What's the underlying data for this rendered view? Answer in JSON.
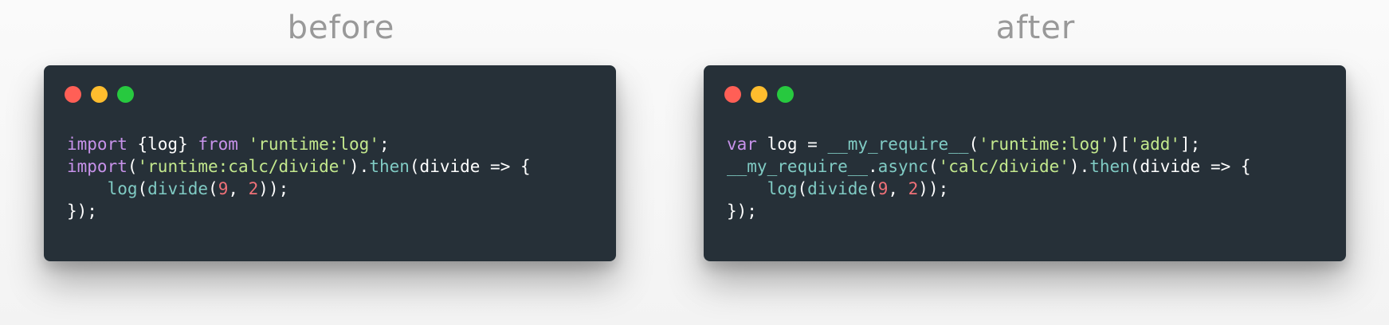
{
  "colors": {
    "background": "#f7f7f7",
    "window": "#263038",
    "label": "#999999",
    "traffic_red": "#ff5f56",
    "traffic_yellow": "#ffbd2e",
    "traffic_green": "#27c93f",
    "keyword": "#c792ea",
    "function": "#80cbc4",
    "string": "#c3e88d",
    "number": "#f07178",
    "text": "#ffffff"
  },
  "panels": [
    {
      "label": "before",
      "lines": [
        [
          {
            "t": "import",
            "c": "kw"
          },
          {
            "t": " {log} ",
            "c": "plain"
          },
          {
            "t": "from",
            "c": "kw"
          },
          {
            "t": " ",
            "c": "plain"
          },
          {
            "t": "'runtime:log'",
            "c": "str"
          },
          {
            "t": ";",
            "c": "plain"
          }
        ],
        [
          {
            "t": "import",
            "c": "kw"
          },
          {
            "t": "(",
            "c": "plain"
          },
          {
            "t": "'runtime:calc/divide'",
            "c": "str"
          },
          {
            "t": ").",
            "c": "plain"
          },
          {
            "t": "then",
            "c": "fn"
          },
          {
            "t": "(divide => {",
            "c": "plain"
          }
        ],
        [
          {
            "t": "    ",
            "c": "plain"
          },
          {
            "t": "log",
            "c": "fn"
          },
          {
            "t": "(",
            "c": "plain"
          },
          {
            "t": "divide",
            "c": "fn"
          },
          {
            "t": "(",
            "c": "plain"
          },
          {
            "t": "9",
            "c": "num"
          },
          {
            "t": ", ",
            "c": "plain"
          },
          {
            "t": "2",
            "c": "num"
          },
          {
            "t": "));",
            "c": "plain"
          }
        ],
        [
          {
            "t": "});",
            "c": "plain"
          }
        ]
      ]
    },
    {
      "label": "after",
      "lines": [
        [
          {
            "t": "var",
            "c": "kw"
          },
          {
            "t": " log = ",
            "c": "plain"
          },
          {
            "t": "__my_require__",
            "c": "fn"
          },
          {
            "t": "(",
            "c": "plain"
          },
          {
            "t": "'runtime:log'",
            "c": "str"
          },
          {
            "t": ")[",
            "c": "plain"
          },
          {
            "t": "'add'",
            "c": "str"
          },
          {
            "t": "];",
            "c": "plain"
          }
        ],
        [
          {
            "t": "__my_require__",
            "c": "fn"
          },
          {
            "t": ".",
            "c": "plain"
          },
          {
            "t": "async",
            "c": "fn"
          },
          {
            "t": "(",
            "c": "plain"
          },
          {
            "t": "'calc/divide'",
            "c": "str"
          },
          {
            "t": ").",
            "c": "plain"
          },
          {
            "t": "then",
            "c": "fn"
          },
          {
            "t": "(divide => {",
            "c": "plain"
          }
        ],
        [
          {
            "t": "    ",
            "c": "plain"
          },
          {
            "t": "log",
            "c": "fn"
          },
          {
            "t": "(",
            "c": "plain"
          },
          {
            "t": "divide",
            "c": "fn"
          },
          {
            "t": "(",
            "c": "plain"
          },
          {
            "t": "9",
            "c": "num"
          },
          {
            "t": ", ",
            "c": "plain"
          },
          {
            "t": "2",
            "c": "num"
          },
          {
            "t": "));",
            "c": "plain"
          }
        ],
        [
          {
            "t": "});",
            "c": "plain"
          }
        ]
      ]
    }
  ]
}
